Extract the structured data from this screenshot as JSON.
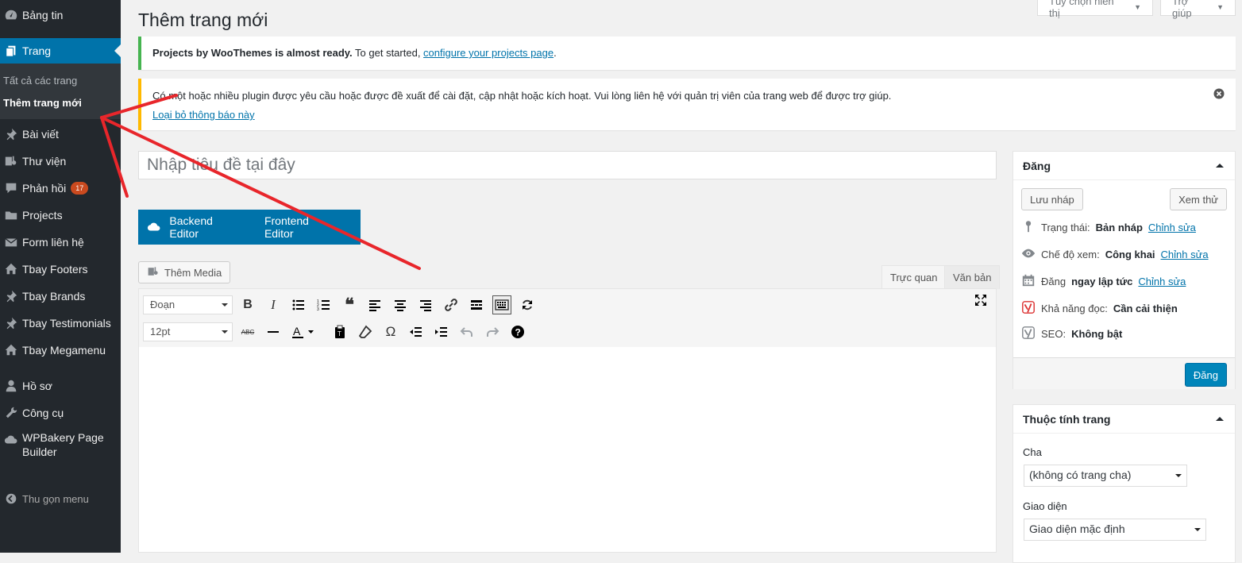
{
  "sidebar": {
    "items": [
      {
        "label": "Bảng tin",
        "icon": "dashboard-icon"
      },
      {
        "label": "Trang",
        "icon": "pages-icon"
      },
      {
        "label": "Bài viết",
        "icon": "pin-icon"
      },
      {
        "label": "Thư viện",
        "icon": "media-icon"
      },
      {
        "label": "Phản hồi",
        "icon": "comments-icon",
        "badge": "17"
      },
      {
        "label": "Projects",
        "icon": "folder-icon"
      },
      {
        "label": "Form liên hệ",
        "icon": "mail-icon"
      },
      {
        "label": "Tbay Footers",
        "icon": "home-icon"
      },
      {
        "label": "Tbay Brands",
        "icon": "pin-icon"
      },
      {
        "label": "Tbay Testimonials",
        "icon": "pin-icon"
      },
      {
        "label": "Tbay Megamenu",
        "icon": "home-icon"
      },
      {
        "label": "Hồ sơ",
        "icon": "user-icon"
      },
      {
        "label": "Công cụ",
        "icon": "wrench-icon"
      },
      {
        "label": "WPBakery Page Builder",
        "icon": "cloud-icon"
      }
    ],
    "submenu": [
      "Tất cả các trang",
      "Thêm trang mới"
    ],
    "collapse": "Thu gọn menu",
    "colors": {
      "bg": "#23282d",
      "active": "#0073aa"
    }
  },
  "header": {
    "title": "Thêm trang mới",
    "screen_options": "Tùy chọn hiển thị",
    "help": "Trợ giúp"
  },
  "notices": {
    "success_bold": "Projects by WooThemes is almost ready.",
    "success_text": " To get started, ",
    "success_link": "configure your projects page",
    "success_end": ".",
    "warning_text": "Có một hoặc nhiều plugin được yêu cầu hoặc được đề xuất để cài đặt, cập nhật hoặc kích hoạt. Vui lòng liên hệ với quản trị viên của trang web để được trợ giúp.",
    "warning_link": "Loại bỏ thông báo này"
  },
  "editor": {
    "title_placeholder": "Nhập tiêu đề tại đây",
    "backend_editor": "Backend Editor",
    "frontend_editor": "Frontend Editor",
    "add_media": "Thêm Media",
    "tab_visual": "Trực quan",
    "tab_text": "Văn bản",
    "format_select": "Đoạn",
    "font_size_select": "12pt"
  },
  "publish_box": {
    "title": "Đăng",
    "save_draft": "Lưu nháp",
    "preview": "Xem thử",
    "status_label": "Trạng thái:",
    "status_value": "Bản nháp",
    "visibility_label": "Chế độ xem:",
    "visibility_value": "Công khai",
    "publish_label": "Đăng",
    "publish_value": "ngay lập tức",
    "edit_link": "Chỉnh sửa",
    "readability_label": "Khả năng đọc:",
    "readability_value": "Cần cải thiện",
    "seo_label": "SEO:",
    "seo_value": "Không bật",
    "publish_button": "Đăng"
  },
  "attributes_box": {
    "title": "Thuộc tính trang",
    "parent_label": "Cha",
    "parent_value": "(không có trang cha)",
    "template_label": "Giao diện",
    "template_value": "Giao diện mặc định"
  }
}
